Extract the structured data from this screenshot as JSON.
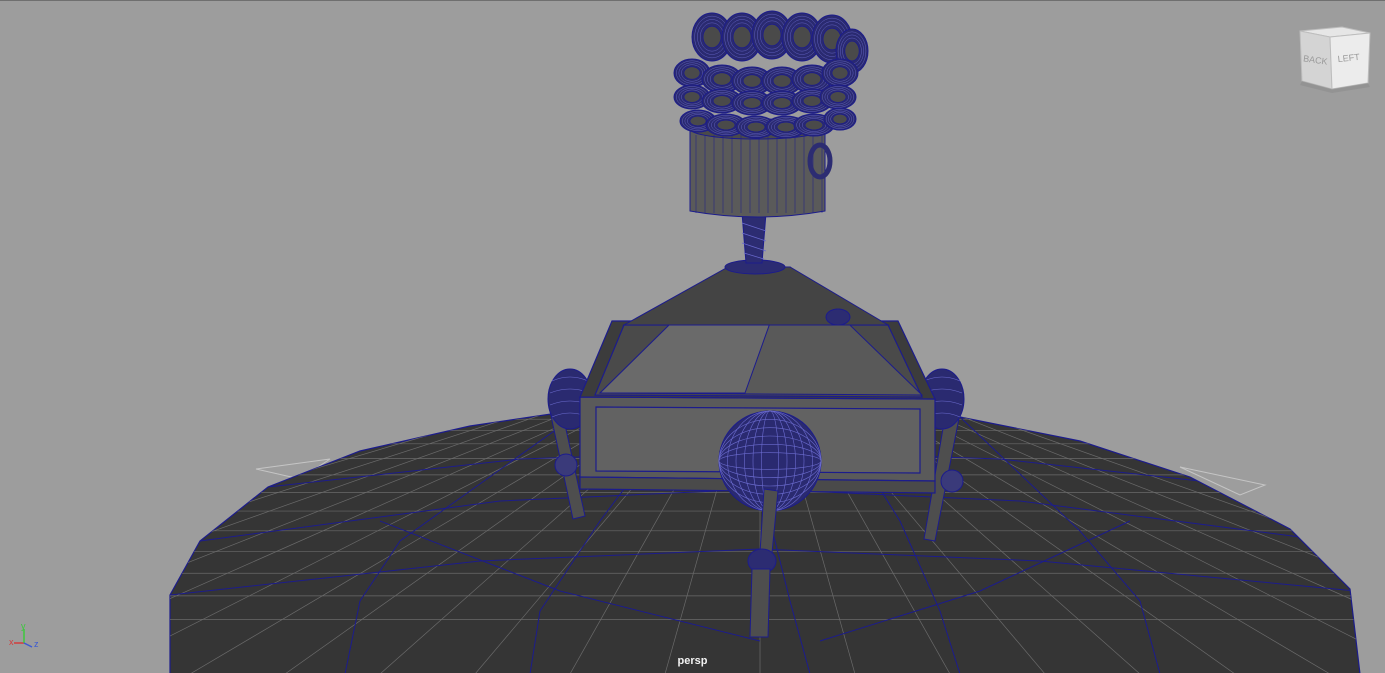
{
  "viewport": {
    "camera_label": "persp",
    "background_color": "#9d9d9d",
    "wireframe_color": "#1c1c8c",
    "shaded_color": "#4a4a4a",
    "ground_color": "#353535"
  },
  "view_cube": {
    "left_face_label": "BACK",
    "right_face_label": "LEFT"
  },
  "axis_gizmo": {
    "x_label": "x",
    "y_label": "y",
    "z_label": "z",
    "x_color": "#d23c3c",
    "y_color": "#3cc83c",
    "z_color": "#3c5ad2"
  }
}
